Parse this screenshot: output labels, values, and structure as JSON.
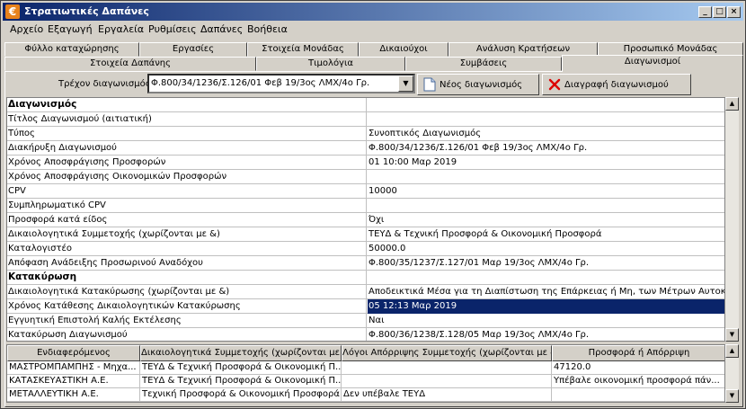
{
  "window": {
    "title": "Στρατιωτικές Δαπάνες",
    "icon": "€"
  },
  "menu": [
    "Αρχείο",
    "Εξαγωγή",
    "Εργαλεία",
    "Ρυθμίσεις",
    "Δαπάνες",
    "Βοήθεια"
  ],
  "tabs_row1": [
    "Φύλλο καταχώρησης",
    "Εργασίες",
    "Στοιχεία Μονάδας",
    "Δικαιούχοι",
    "Ανάλυση Κρατήσεων",
    "Προσωπικό Μονάδας"
  ],
  "tabs_row2": [
    "Στοιχεία Δαπάνης",
    "Τιμολόγια",
    "Συμβάσεις",
    "Διαγωνισμοί"
  ],
  "active_tab": "Διαγωνισμοί",
  "current": {
    "label": "Τρέχον διαγωνισμός:",
    "value": "Φ.800/34/1236/Σ.126/01 Φεβ 19/3ος ΛΜΧ/4ο Γρ."
  },
  "buttons": {
    "new": "Νέος διαγωνισμός",
    "delete": "Διαγραφή διαγωνισμού"
  },
  "properties": [
    {
      "section": true,
      "name": "Διαγωνισμός",
      "value": ""
    },
    {
      "name": "Τίτλος Διαγωνισμού (αιτιατική)",
      "value": ""
    },
    {
      "name": "Τύπος",
      "value": "Συνοπτικός Διαγωνισμός"
    },
    {
      "name": "Διακήρυξη Διαγωνισμού",
      "value": "Φ.800/34/1236/Σ.126/01 Φεβ 19/3ος ΛΜΧ/4ο Γρ."
    },
    {
      "name": "Χρόνος Αποσφράγισης Προσφορών",
      "value": "01 10:00 Μαρ 2019"
    },
    {
      "name": "Χρόνος Αποσφράγισης Οικονομικών Προσφορών",
      "value": ""
    },
    {
      "name": "CPV",
      "value": "10000"
    },
    {
      "name": "Συμπληρωματικό CPV",
      "value": ""
    },
    {
      "name": "Προσφορά κατά είδος",
      "value": "Όχι"
    },
    {
      "name": "Δικαιολογητικά Συμμετοχής (χωρίζονται με &)",
      "value": "ΤΕΥΔ & Τεχνική Προσφορά & Οικονομική Προσφορά"
    },
    {
      "name": "Καταλογιστέο",
      "value": "50000.0"
    },
    {
      "name": "Απόφαση Ανάδειξης Προσωρινού Αναδόχου",
      "value": "Φ.800/35/1237/Σ.127/01 Μαρ 19/3ος ΛΜΧ/4ο Γρ."
    },
    {
      "section": true,
      "name": "Κατακύρωση",
      "value": ""
    },
    {
      "name": "Δικαιολογητικά Κατακύρωσης (χωρίζονται με &)",
      "value": "Αποδεικτικά Μέσα για τη Διαπίστωση της Επάρκειας ή Μη, των Μέτρων Αυτοκάθ..."
    },
    {
      "name": "Χρόνος Κατάθεσης Δικαιολογητικών Κατακύρωσης",
      "value": "05 12:13 Μαρ 2019",
      "selected": true
    },
    {
      "name": "Εγγυητική Επιστολή Καλής Εκτέλεσης",
      "value": "Ναι"
    },
    {
      "name": "Κατακύρωση Διαγωνισμού",
      "value": "Φ.800/36/1238/Σ.128/05 Μαρ 19/3ος ΛΜΧ/4ο Γρ."
    }
  ],
  "bidders": {
    "columns": [
      "Ενδιαφερόμενος",
      "Δικαιολογητικά Συμμετοχής (χωρίζονται με &)",
      "Λόγοι Απόρριψης Συμμετοχής (χωρίζονται με &)",
      "Προσφορά ή Απόρριψη"
    ],
    "rows": [
      [
        "ΜΑΣΤΡΟΜΠΑΜΠΗΣ - Μηχα...",
        "ΤΕΥΔ & Τεχνική Προσφορά & Οικονομική Π...",
        "",
        "47120.0"
      ],
      [
        "ΚΑΤΑΣΚΕΥΑΣΤΙΚΗ Α.Ε.",
        "ΤΕΥΔ & Τεχνική Προσφορά & Οικονομική Π...",
        "",
        "Υπέβαλε οικονομική προσφορά πάν..."
      ],
      [
        "ΜΕΤΑΛΛΕΥΤΙΚΗ Α.Ε.",
        "Τεχνική Προσφορά & Οικονομική Προσφορά",
        "Δεν υπέβαλε ΤΕΥΔ",
        ""
      ]
    ]
  }
}
